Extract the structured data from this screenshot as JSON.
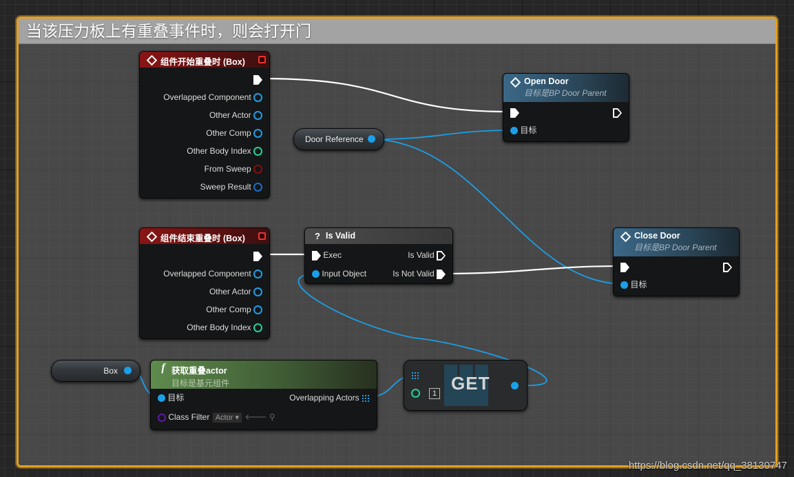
{
  "comment": {
    "title": "当该压力板上有重叠事件时，则会打开门"
  },
  "begin_overlap": {
    "title": "组件开始重叠时 (Box)",
    "pins": [
      "Overlapped Component",
      "Other Actor",
      "Other Comp",
      "Other Body Index",
      "From Sweep",
      "Sweep Result"
    ]
  },
  "end_overlap": {
    "title": "组件结束重叠时 (Box)",
    "pins": [
      "Overlapped Component",
      "Other Actor",
      "Other Comp",
      "Other Body Index"
    ]
  },
  "open_door": {
    "title": "Open Door",
    "subtitle": "目标是BP Door Parent",
    "target_label": "目标"
  },
  "close_door": {
    "title": "Close Door",
    "subtitle": "目标是BP Door Parent",
    "target_label": "目标"
  },
  "door_reference": {
    "label": "Door Reference"
  },
  "is_valid": {
    "title": "Is Valid",
    "exec_label": "Exec",
    "input_label": "Input Object",
    "valid_label": "Is Valid",
    "not_valid_label": "Is Not Valid"
  },
  "box_var": {
    "label": "Box"
  },
  "get_overlapping": {
    "title": "获取重叠actor",
    "subtitle": "目标是基元组件",
    "target_label": "目标",
    "output_label": "Overlapping Actors",
    "filter_label": "Class Filter",
    "filter_value": "Actor"
  },
  "get_node": {
    "label": "GET",
    "index": "1"
  },
  "watermark": "https://blog.csdn.net/qq_38130747",
  "colors": {
    "object_pin": "#1a9fe8",
    "int_pin": "#1ed49a",
    "bool_pin": "#8a0c0c",
    "struct_pin": "#1a6fc8",
    "class_pin": "#5e1aa8",
    "comment_border": "#e3a021"
  }
}
